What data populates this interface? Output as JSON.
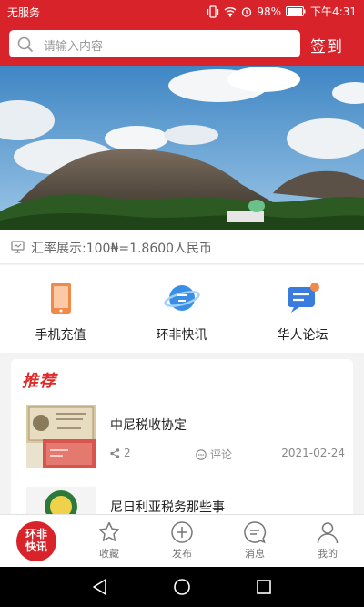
{
  "status_bar": {
    "carrier": "无服务",
    "battery": "98%",
    "time": "下午4:31"
  },
  "search": {
    "placeholder": "请输入内容"
  },
  "header": {
    "signin_label": "签到"
  },
  "exchange": {
    "text": "汇率展示:100₦=1.8600人民币"
  },
  "quick_menu": [
    {
      "label": "手机充值",
      "icon": "phone-icon",
      "color": "#f08a4b"
    },
    {
      "label": "环非快讯",
      "icon": "planet-icon",
      "color": "#3a8ee6"
    },
    {
      "label": "华人论坛",
      "icon": "chat-icon",
      "color": "#3a7be0"
    }
  ],
  "recommend": {
    "title": "推荐",
    "items": [
      {
        "title": "中尼税收协定",
        "shares": "2",
        "comment_label": "评论",
        "date": "2021-02-24"
      },
      {
        "title": "尼日利亚税务那些事"
      }
    ]
  },
  "tabbar": {
    "logo_text_line1": "环非",
    "logo_text_line2": "快讯",
    "items": [
      {
        "label": "收藏",
        "icon": "star-icon"
      },
      {
        "label": "发布",
        "icon": "plus-circle-icon"
      },
      {
        "label": "消息",
        "icon": "message-icon"
      },
      {
        "label": "我的",
        "icon": "user-icon"
      }
    ]
  },
  "colors": {
    "brand_red": "#d8232a",
    "recommend_red": "#e02a2a"
  }
}
